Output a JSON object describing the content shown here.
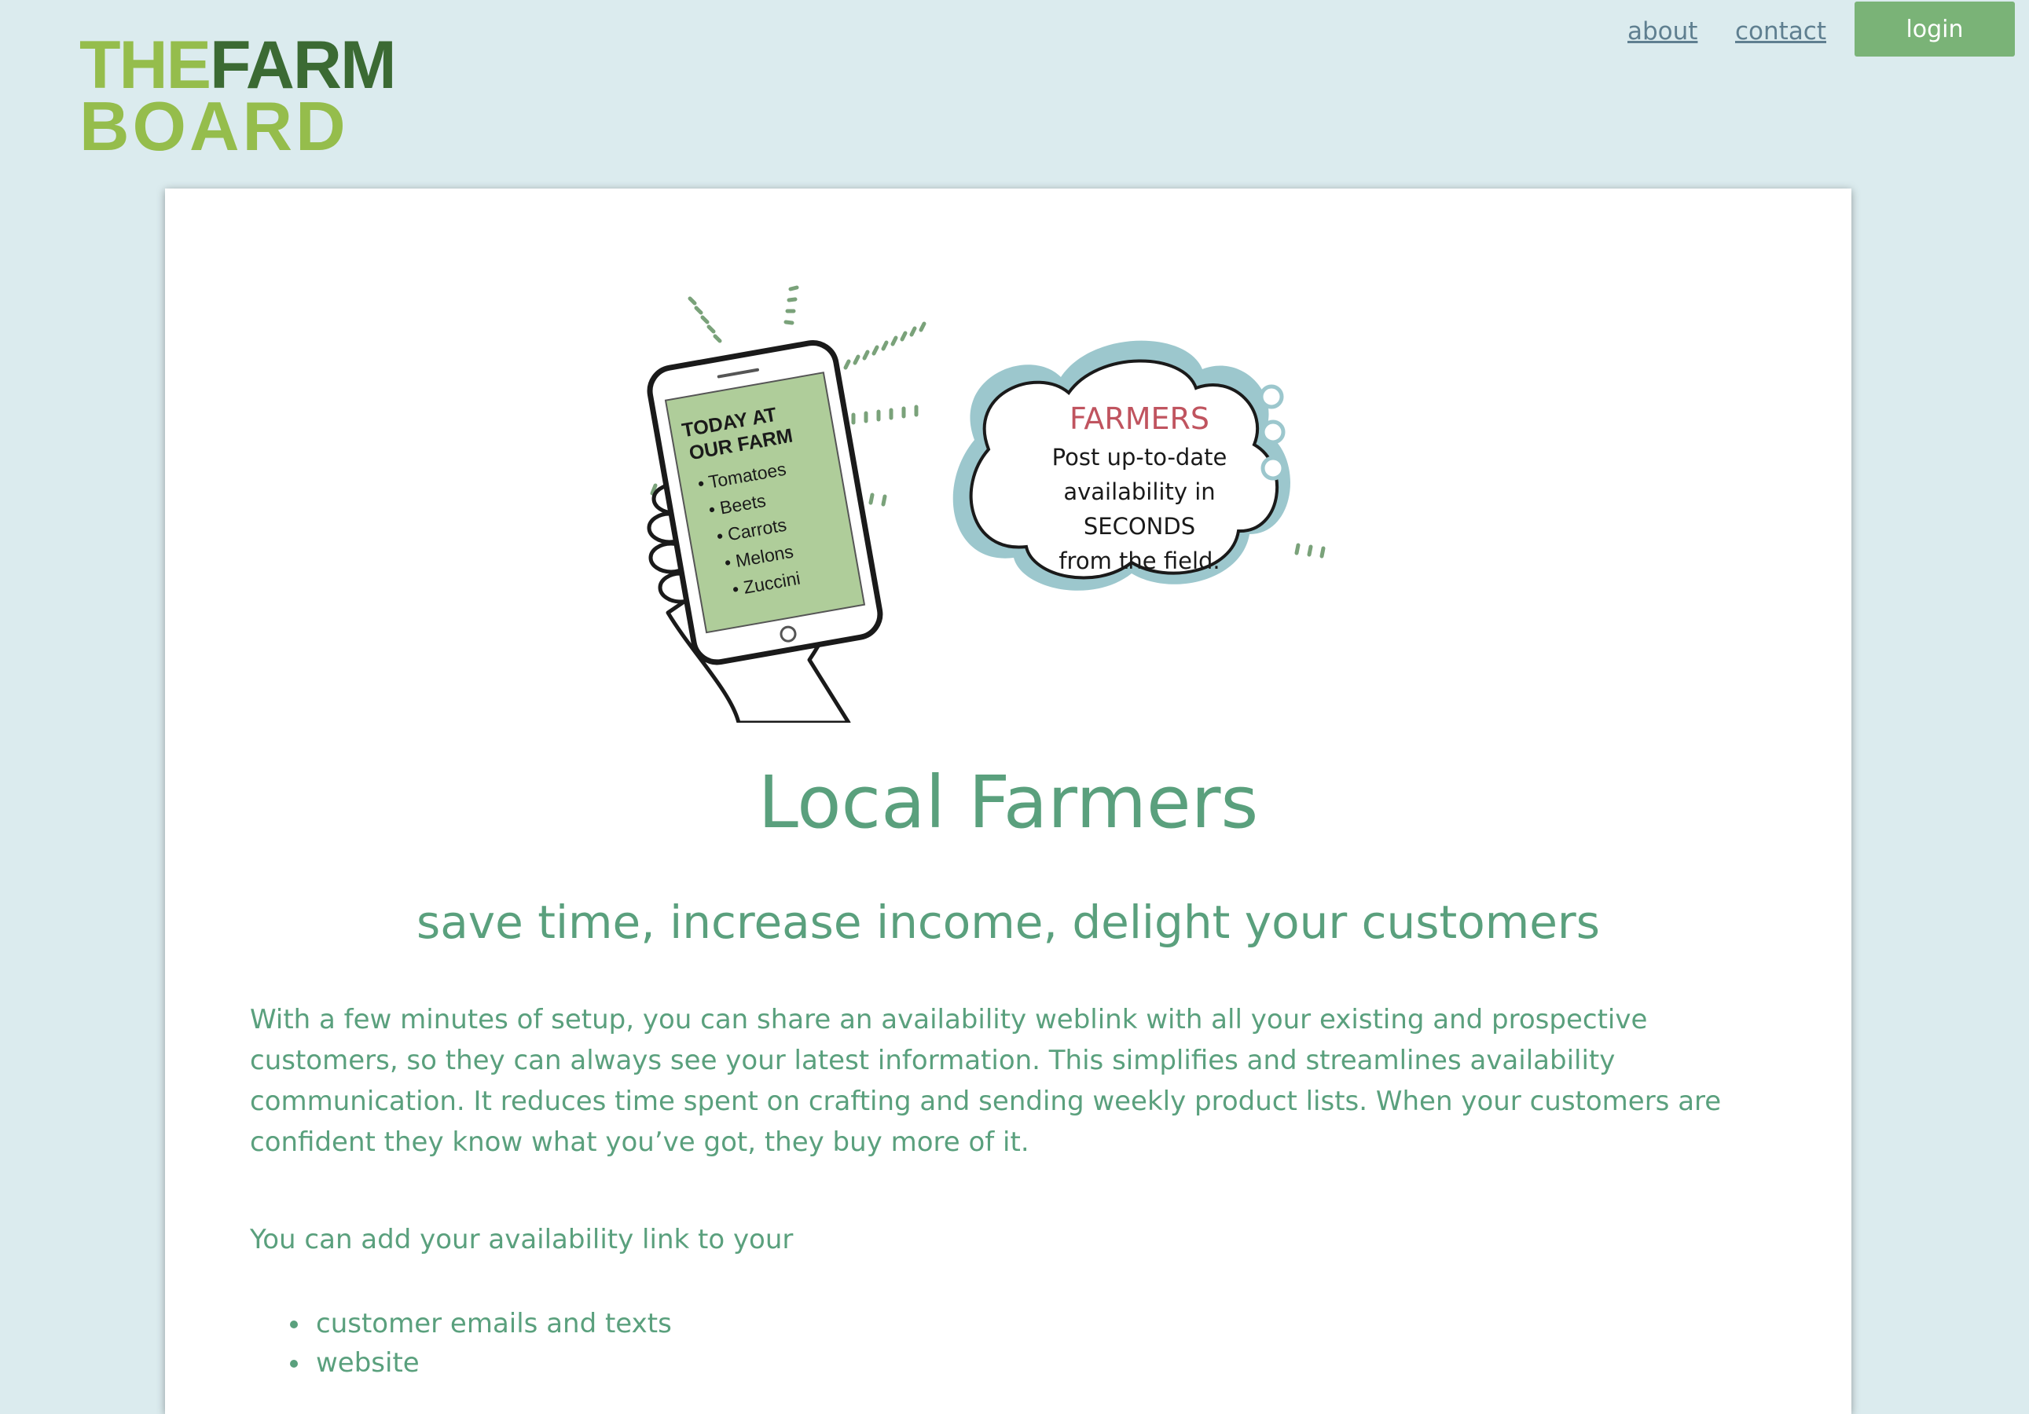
{
  "logo": {
    "line1_a": "THE",
    "line1_b": "FARM",
    "line2": "BOARD"
  },
  "nav": {
    "about": "about",
    "contact": "contact",
    "login": "login"
  },
  "hero": {
    "phone_title_1": "TODAY AT",
    "phone_title_2": "OUR FARM",
    "phone_items": [
      "Tomatoes",
      "Beets",
      "Carrots",
      "Melons",
      "Zuccini"
    ],
    "bubble_title": "FARMERS",
    "bubble_lines": [
      "Post up-to-date",
      "availability in",
      "SECONDS",
      "from the field."
    ]
  },
  "content": {
    "heading": "Local Farmers",
    "subheading": "save time, increase income, delight your customers",
    "paragraph": "With a few minutes of setup, you can share an availability weblink with all your existing and prospective customers, so they can always see your latest information. This simplifies and streamlines availability communication. It reduces time spent on crafting and sending weekly product lists. When your customers are confident they know what you’ve got, they buy more of it.",
    "paragraph2": "You can add your availability link to your",
    "list": [
      "customer emails and texts",
      "website"
    ]
  },
  "colors": {
    "background": "#dbebee",
    "accent_green": "#5aa07d",
    "button_green": "#7ab377",
    "logo_light": "#95bd4c",
    "logo_dark": "#3b6a33",
    "phone_screen": "#afcd9a",
    "bubble_title": "#c0545f",
    "cloud_shadow": "#9cc7cd"
  }
}
